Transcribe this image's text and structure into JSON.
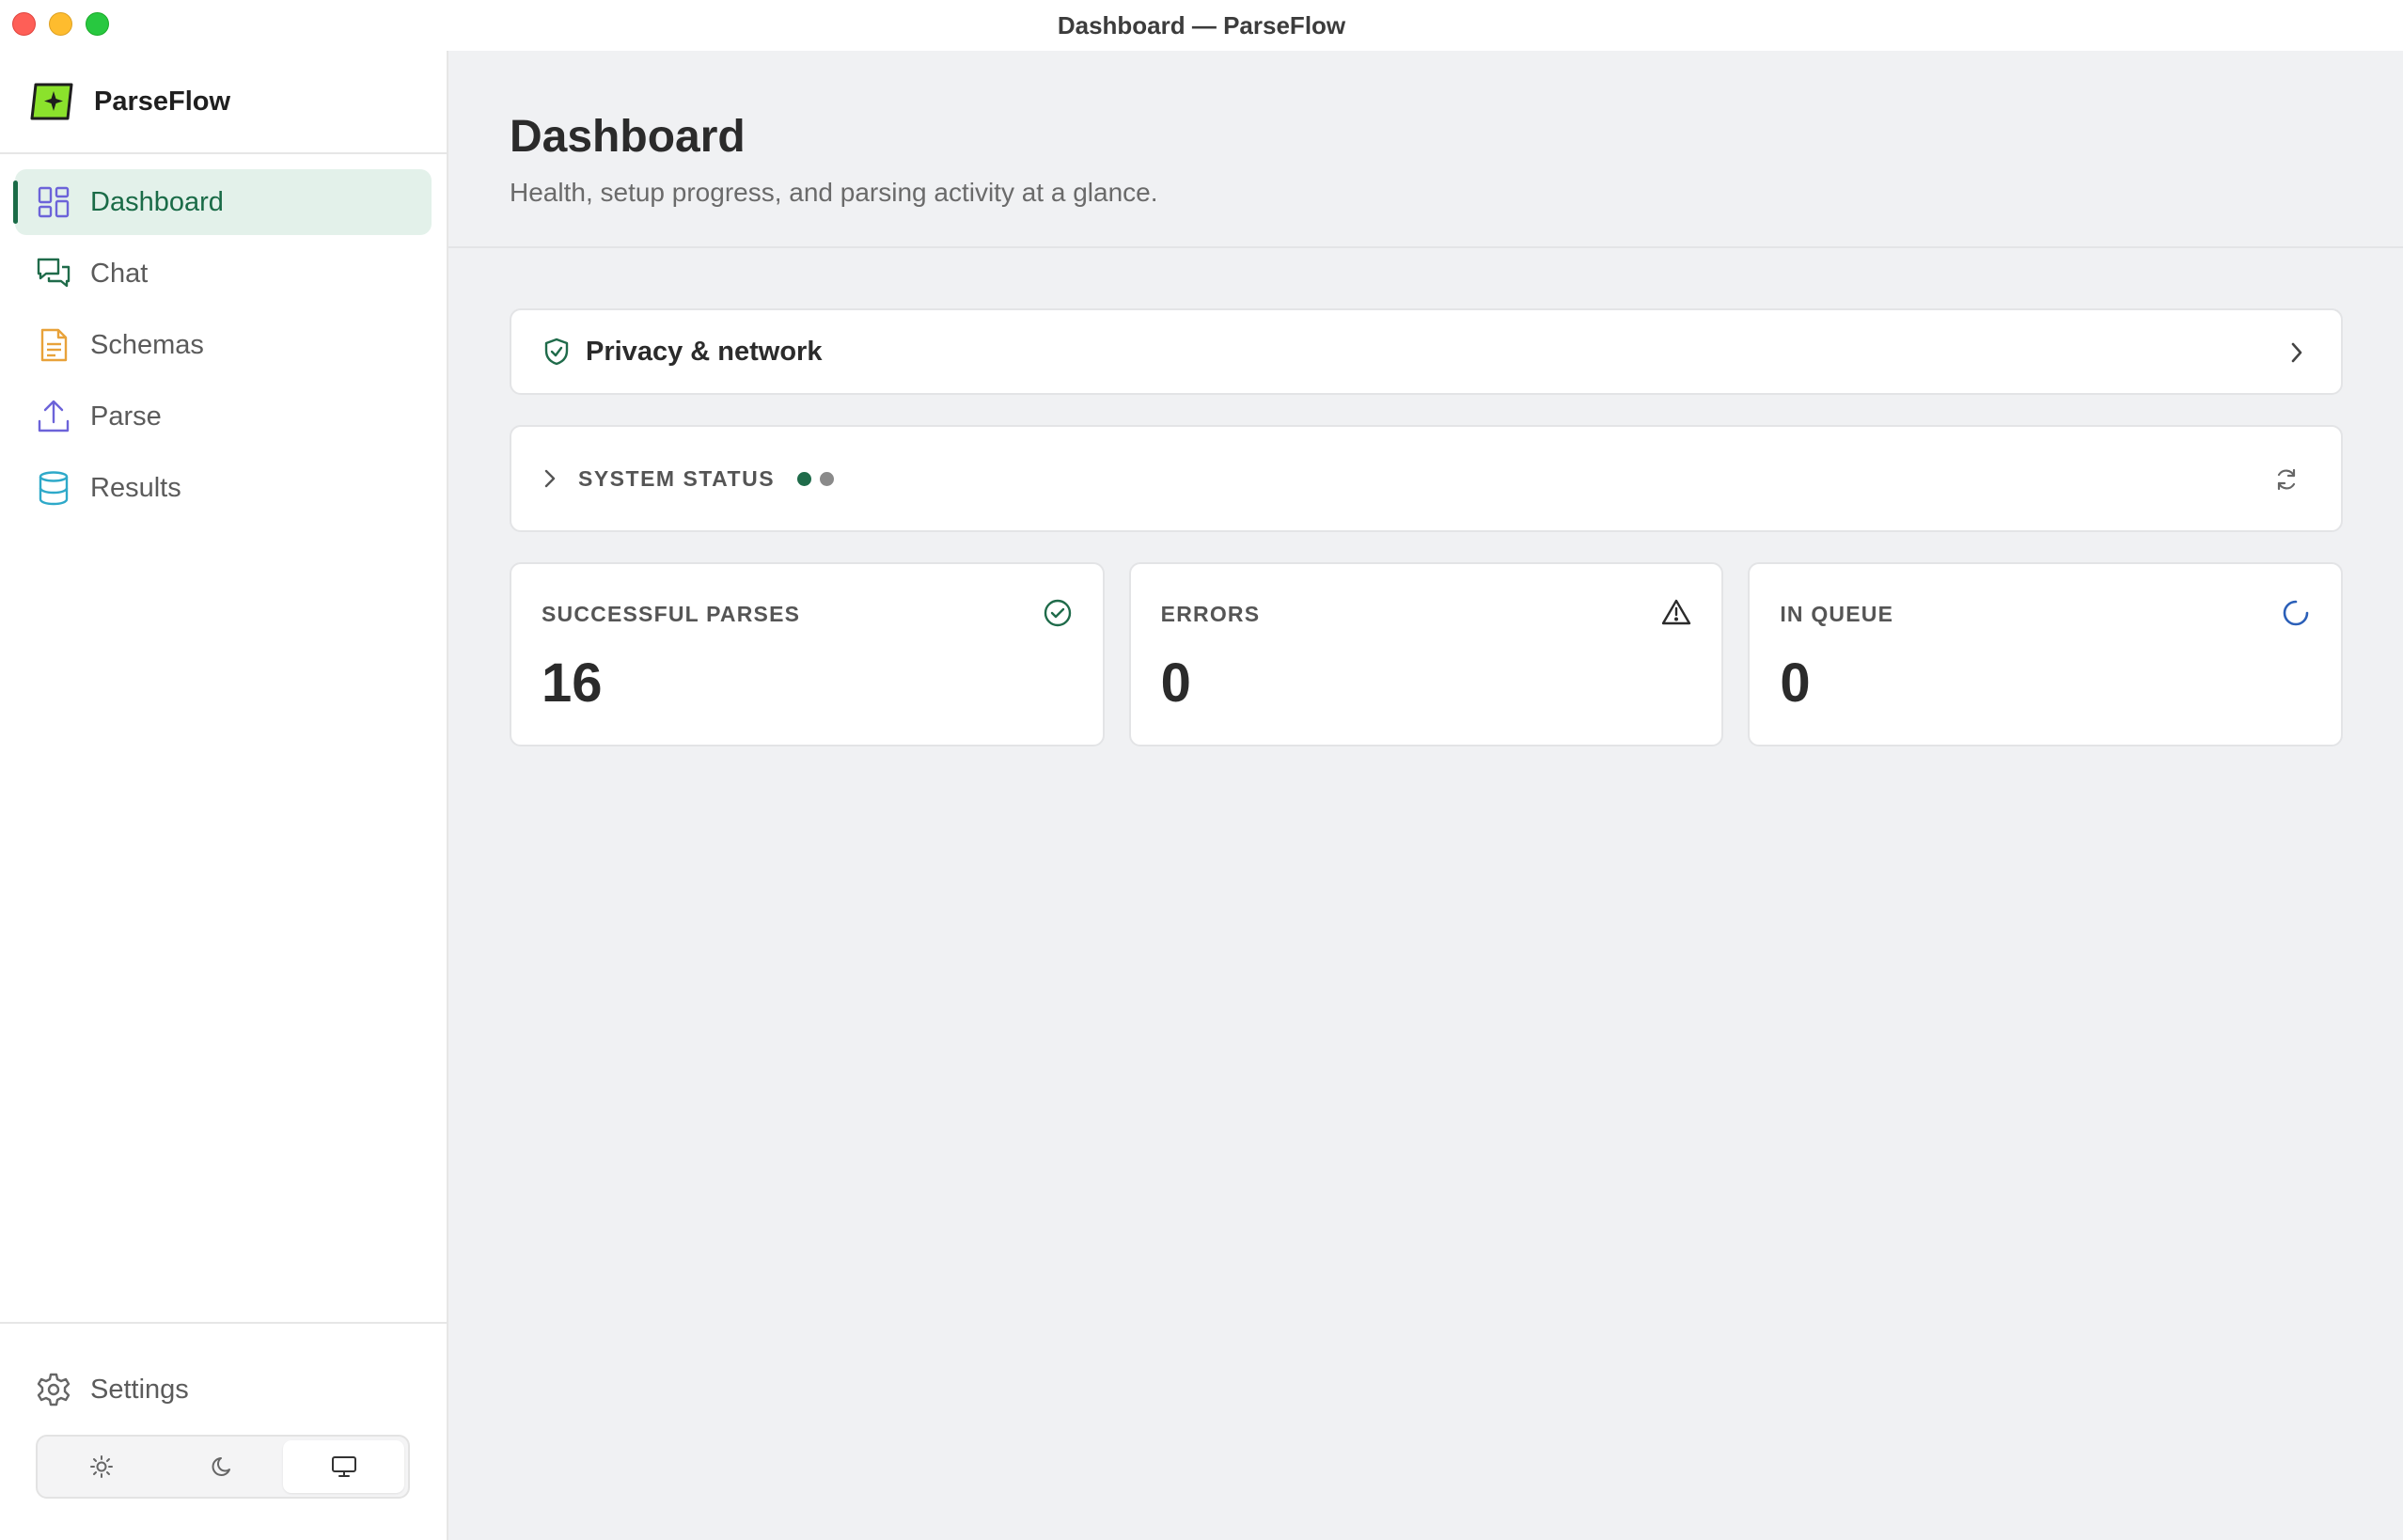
{
  "window": {
    "title": "Dashboard — ParseFlow"
  },
  "sidebar": {
    "brand": "ParseFlow",
    "items": [
      {
        "label": "Dashboard",
        "icon": "dashboard-grid-icon",
        "active": true
      },
      {
        "label": "Chat",
        "icon": "chat-bubbles-icon",
        "active": false
      },
      {
        "label": "Schemas",
        "icon": "document-icon",
        "active": false
      },
      {
        "label": "Parse",
        "icon": "upload-icon",
        "active": false
      },
      {
        "label": "Results",
        "icon": "database-icon",
        "active": false
      }
    ],
    "settings_label": "Settings",
    "theme": {
      "options": [
        "light",
        "dark",
        "system"
      ],
      "selected": "system"
    }
  },
  "main": {
    "title": "Dashboard",
    "subtitle": "Health, setup progress, and parsing activity at a glance.",
    "privacy_label": "Privacy & network",
    "system_status_label": "SYSTEM STATUS",
    "status_dots": [
      "#1f6b4a",
      "#8a8a8a"
    ],
    "stats": [
      {
        "label": "SUCCESSFUL PARSES",
        "value": "16",
        "icon": "check-circle-icon"
      },
      {
        "label": "ERRORS",
        "value": "0",
        "icon": "warning-triangle-icon"
      },
      {
        "label": "IN QUEUE",
        "value": "0",
        "icon": "spinner-icon"
      }
    ]
  },
  "colors": {
    "accent": "#1a6b47",
    "active_bg": "#e3f1ea",
    "brand_green": "#8be22c",
    "queue_blue": "#2b5fb8"
  }
}
